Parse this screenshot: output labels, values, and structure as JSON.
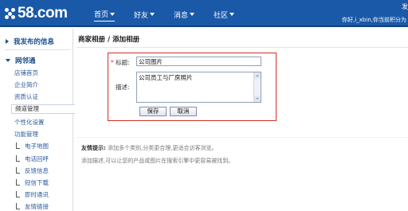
{
  "brand": {
    "logo_text": "58.com"
  },
  "nav": [
    {
      "label": "首页"
    },
    {
      "label": "好友"
    },
    {
      "label": "消息"
    },
    {
      "label": "社区"
    }
  ],
  "header": {
    "edge_text": "发",
    "greeting": "你好,i_xbin,你当前积分为"
  },
  "sidebar": {
    "my_posts": "我发布的信息",
    "wanglintong": "网邻通",
    "links": [
      "店铺首页",
      "企业简介",
      "资质认证",
      "频道管理",
      "个性化设置",
      "功能管理"
    ],
    "sub_links": [
      "电子地图",
      "电话回呼",
      "反馈信息",
      "短信下载",
      "即时通讯",
      "友情链接"
    ]
  },
  "breadcrumb": {
    "section": "商家相册",
    "separator": "/",
    "page": "添加相册"
  },
  "form": {
    "required_mark": "*",
    "title_label": "标题:",
    "title_value": "公司图片",
    "desc_label": "描述:",
    "desc_value": "公司员工与厂房照片",
    "save_label": "保存",
    "cancel_label": "取消"
  },
  "tips": {
    "heading": "友情提示:",
    "line1": "添加多个类别,分类更合理,更适合访客浏览。",
    "line2": "添加描述,可以让您的产品或图片在搜索引擎中更容易被找到。"
  },
  "colors": {
    "header_bg": "#1a59a8",
    "link": "#2b5aa0",
    "highlight_border": "#d0302a"
  }
}
